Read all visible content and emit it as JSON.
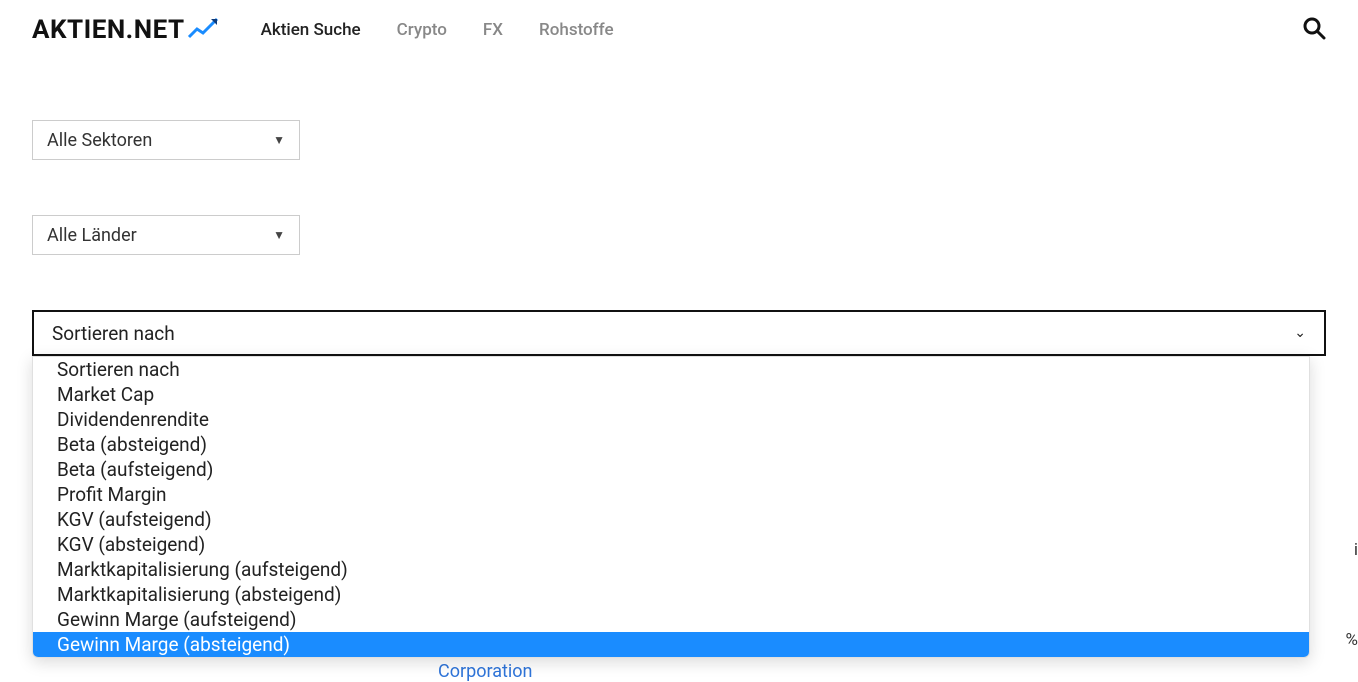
{
  "header": {
    "logo_text": "AKTIEN.NET",
    "nav": [
      {
        "label": "Aktien Suche",
        "active": true
      },
      {
        "label": "Crypto",
        "active": false
      },
      {
        "label": "FX",
        "active": false
      },
      {
        "label": "Rohstoffe",
        "active": false
      }
    ]
  },
  "filters": {
    "sector": {
      "selected": "Alle Sektoren"
    },
    "country": {
      "selected": "Alle Länder"
    }
  },
  "sort": {
    "label": "Sortieren nach",
    "options": [
      "Sortieren nach",
      "Market Cap",
      "Dividendenrendite",
      "Beta (absteigend)",
      "Beta (aufsteigend)",
      "Profit Margin",
      "KGV (aufsteigend)",
      "KGV (absteigend)",
      "Marktkapitalisierung (aufsteigend)",
      "Marktkapitalisierung (absteigend)",
      "Gewinn Marge (aufsteigend)",
      "Gewinn Marge (absteigend)"
    ],
    "highlighted_index": 11
  },
  "background": {
    "partial_header": "i",
    "partial_percent": "%",
    "link_text": "Corporation"
  }
}
